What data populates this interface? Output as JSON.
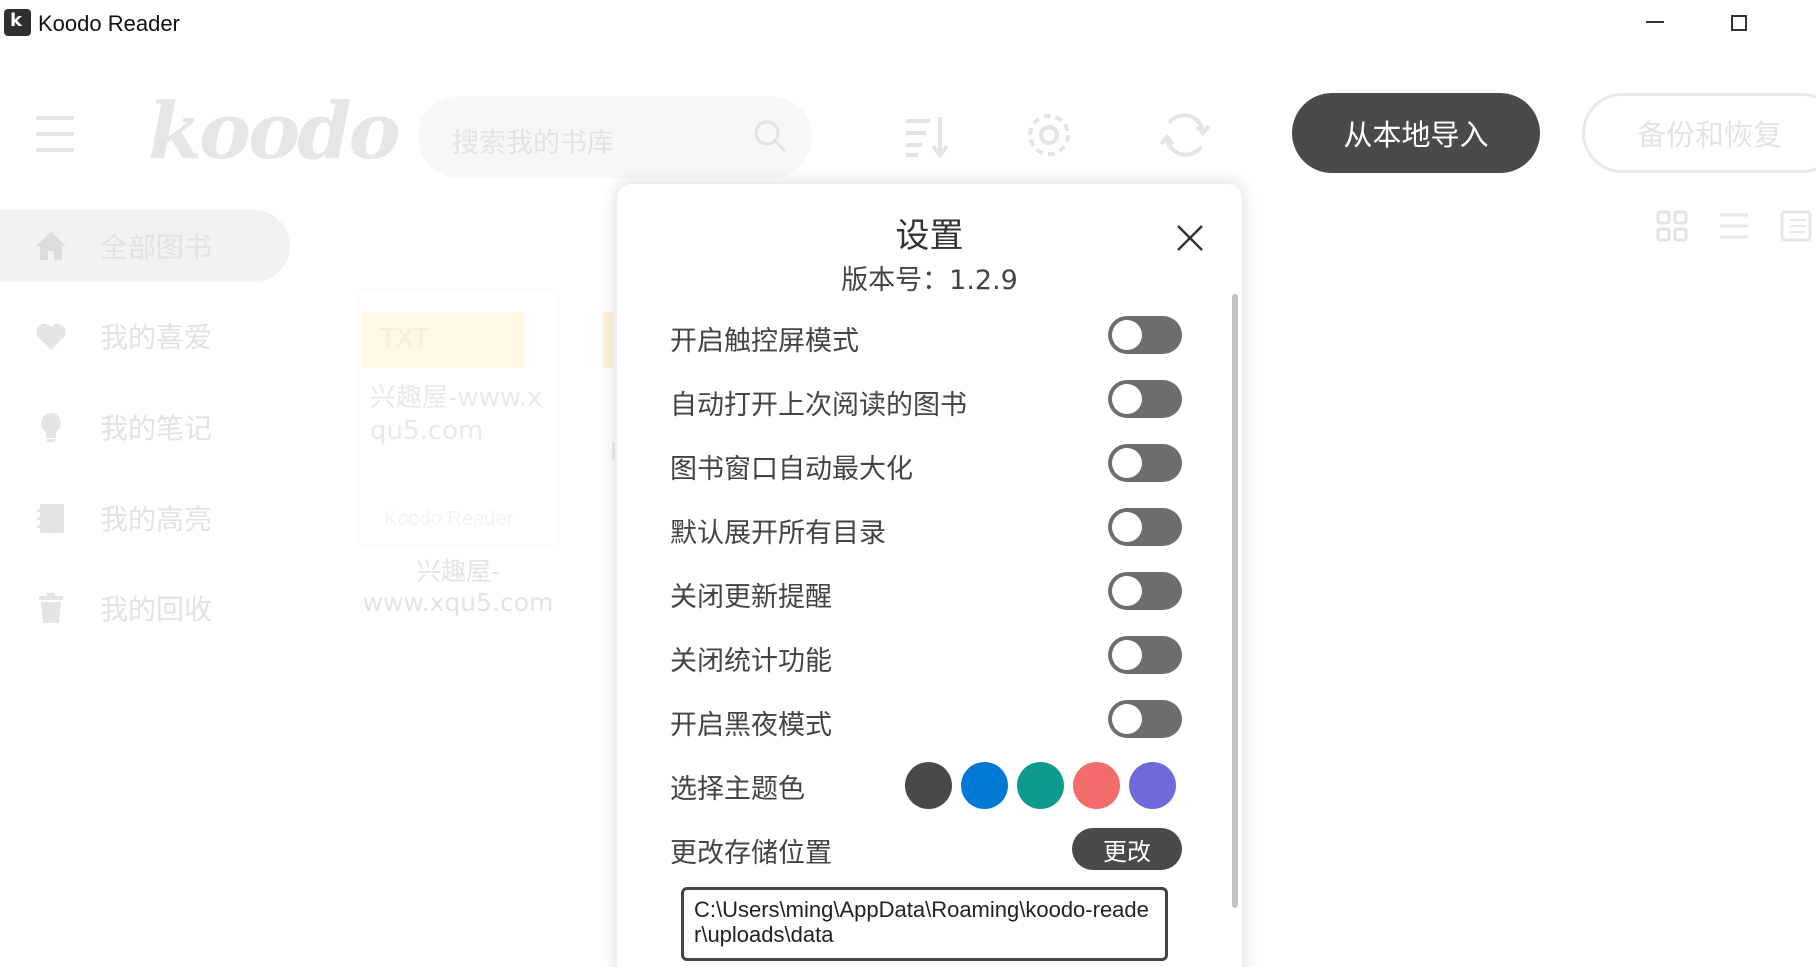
{
  "window": {
    "title": "Koodo Reader"
  },
  "header": {
    "logo_text": "koodo",
    "search_placeholder": "搜索我的书库",
    "import_button": "从本地导入",
    "backup_button": "备份和恢复"
  },
  "sidebar": {
    "items": [
      {
        "label": "全部图书",
        "icon": "home-icon",
        "active": true
      },
      {
        "label": "我的喜爱",
        "icon": "heart-icon",
        "active": false
      },
      {
        "label": "我的笔记",
        "icon": "lightbulb-icon",
        "active": false
      },
      {
        "label": "我的高亮",
        "icon": "notebook-icon",
        "active": false
      },
      {
        "label": "我的回收",
        "icon": "trash-icon",
        "active": false
      }
    ]
  },
  "book": {
    "format_tag": "TXT",
    "cover_title": "兴趣屋-www.xqu5.com",
    "brand": "Koodo Reader",
    "caption_line1": "兴趣屋-",
    "caption_line2": "www.xqu5.com"
  },
  "settings": {
    "title": "设置",
    "version": "版本号：1.2.9",
    "toggles": [
      {
        "label": "开启触控屏模式",
        "on": false
      },
      {
        "label": "自动打开上次阅读的图书",
        "on": false
      },
      {
        "label": "图书窗口自动最大化",
        "on": false
      },
      {
        "label": "默认展开所有目录",
        "on": false
      },
      {
        "label": "关闭更新提醒",
        "on": false
      },
      {
        "label": "关闭统计功能",
        "on": false
      },
      {
        "label": "开启黑夜模式",
        "on": false
      }
    ],
    "theme_label": "选择主题色",
    "theme_colors": [
      "#494949",
      "#0078d4",
      "#0e9a8c",
      "#f36c6c",
      "#6f6adc"
    ],
    "storage_label": "更改存储位置",
    "change_button": "更改",
    "storage_path": "C:\\Users\\ming\\AppData\\Roaming\\koodo-reader\\uploads\\data"
  }
}
